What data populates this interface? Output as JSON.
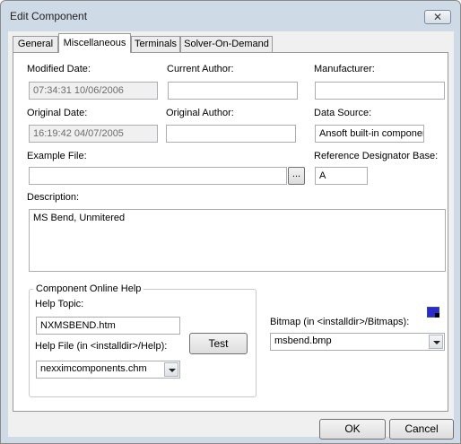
{
  "window": {
    "title": "Edit Component",
    "close_glyph": "✕"
  },
  "tabs": [
    {
      "label": "General"
    },
    {
      "label": "Miscellaneous"
    },
    {
      "label": "Terminals"
    },
    {
      "label": "Solver-On-Demand"
    }
  ],
  "fields": {
    "modified_date": {
      "label": "Modified Date:",
      "value": "07:34:31 10/06/2006"
    },
    "current_author": {
      "label": "Current Author:",
      "value": ""
    },
    "manufacturer": {
      "label": "Manufacturer:",
      "value": ""
    },
    "original_date": {
      "label": "Original Date:",
      "value": "16:19:42 04/07/2005"
    },
    "original_author": {
      "label": "Original Author:",
      "value": ""
    },
    "data_source": {
      "label": "Data Source:",
      "value": "Ansoft built-in component"
    },
    "example_file": {
      "label": "Example File:",
      "value": "",
      "browse": "..."
    },
    "ref_designator": {
      "label": "Reference Designator Base:",
      "value": "A"
    },
    "description": {
      "label": "Description:",
      "value": "MS Bend, Unmitered"
    }
  },
  "online_help": {
    "legend": "Component Online Help",
    "topic_label": "Help Topic:",
    "topic_value": "NXMSBEND.htm",
    "file_label": "Help File (in <installdir>/Help):",
    "file_value": "nexximcomponents.chm",
    "test_label": "Test"
  },
  "bitmap": {
    "label": "Bitmap (in <installdir>/Bitmaps):",
    "value": "msbend.bmp",
    "icon": "component-bitmap-icon"
  },
  "buttons": {
    "ok": "OK",
    "cancel": "Cancel"
  }
}
